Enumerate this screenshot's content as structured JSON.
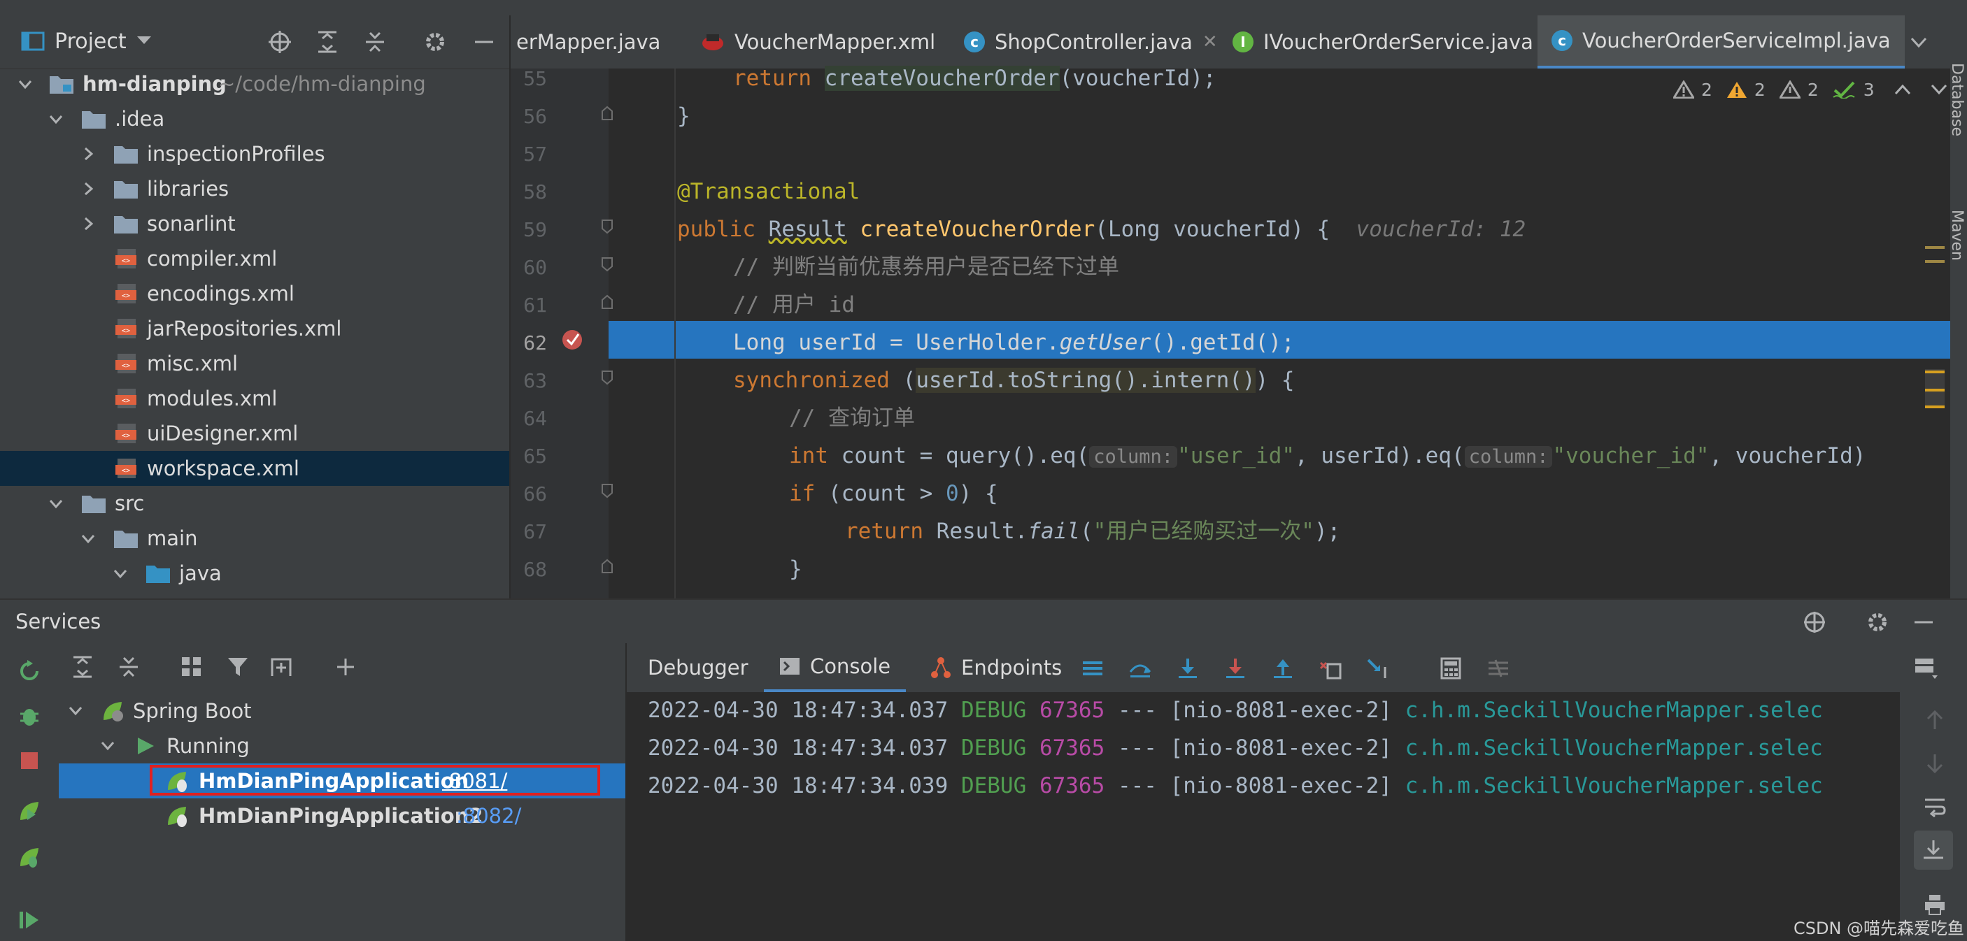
{
  "colors": {
    "accent": "#4a88c7",
    "selection": "#2675bf",
    "panel": "#3c3f41",
    "editor": "#2b2b2b"
  },
  "project_panel": {
    "title": "Project",
    "tree": [
      {
        "label": "hm-dianping",
        "extra": "~/code/hm-dianping",
        "icon": "module-folder-icon",
        "bold": true
      },
      {
        "label": ".idea",
        "icon": "folder-icon"
      },
      {
        "label": "inspectionProfiles",
        "icon": "folder-icon"
      },
      {
        "label": "libraries",
        "icon": "folder-icon"
      },
      {
        "label": "sonarlint",
        "icon": "folder-icon"
      },
      {
        "label": "compiler.xml",
        "icon": "xml-file-icon"
      },
      {
        "label": "encodings.xml",
        "icon": "xml-file-icon"
      },
      {
        "label": "jarRepositories.xml",
        "icon": "xml-file-icon"
      },
      {
        "label": "misc.xml",
        "icon": "xml-file-icon"
      },
      {
        "label": "modules.xml",
        "icon": "xml-file-icon"
      },
      {
        "label": "uiDesigner.xml",
        "icon": "xml-file-icon"
      },
      {
        "label": "workspace.xml",
        "icon": "xml-file-icon",
        "selected": true
      },
      {
        "label": "src",
        "icon": "folder-icon"
      },
      {
        "label": "main",
        "icon": "folder-icon"
      },
      {
        "label": "java",
        "icon": "source-folder-icon"
      }
    ]
  },
  "editor": {
    "tabs": [
      {
        "label": "erMapper.java",
        "kind": "c"
      },
      {
        "label": "VoucherMapper.xml",
        "kind": "xml"
      },
      {
        "label": "ShopController.java",
        "kind": "c"
      },
      {
        "label": "IVoucherOrderService.java",
        "kind": "i"
      },
      {
        "label": "VoucherOrderServiceImpl.java",
        "kind": "c",
        "active": true
      }
    ],
    "inspections": {
      "warn1": "2",
      "warn2": "2",
      "warn3": "2",
      "ok": "3"
    },
    "line_numbers": [
      "55",
      "56",
      "57",
      "58",
      "59",
      "60",
      "61",
      "62",
      "63",
      "64",
      "65",
      "66",
      "67",
      "68"
    ],
    "code": {
      "l55_return": "return ",
      "l55_call": "createVoucherOrder",
      "l55_rest": "(voucherId);",
      "l56": "}",
      "l58": "@Transactional",
      "l59_public": "public ",
      "l59_result": "Result",
      "l59_sp": " ",
      "l59_fn": "createVoucherOrder",
      "l59_rest": "(Long voucherId) {",
      "l59_hint": "voucherId: 12",
      "l60": "// 判断当前优惠券用户是否已经下过单",
      "l61": "// 用户 id",
      "l62_a": "Long userId = UserHolder.",
      "l62_b": "getUser",
      "l62_c": "().getId();",
      "l63_kw": "synchronized ",
      "l63_a": "(",
      "l63_b": "userId.toString().intern()",
      "l63_c": ") {",
      "l64": "// 查询订单",
      "l65_int": "int ",
      "l65_a": "count = query().eq(",
      "l65_hint1": "column:",
      "l65_s1": "\"user_id\"",
      "l65_b": ", userId).eq(",
      "l65_hint2": "column:",
      "l65_s2": "\"voucher_id\"",
      "l65_c": ", voucherId)",
      "l66_if": "if ",
      "l66_a": "(count > ",
      "l66_num": "0",
      "l66_b": ") {",
      "l67_ret": "return ",
      "l67_a": "Result.",
      "l67_fail": "fail",
      "l67_b": "(",
      "l67_str": "\"用户已经购买过一次\"",
      "l67_c": ");",
      "l68": "}"
    }
  },
  "right_toolwindows": {
    "database": "Database",
    "maven": "Maven"
  },
  "services": {
    "title": "Services",
    "tree": {
      "group": "Spring Boot",
      "status": "Running",
      "apps": [
        {
          "name": "HmDianPingApplication",
          "port": ":8081/",
          "selected": true
        },
        {
          "name": "HmDianPingApplication2",
          "port": ":8082/"
        }
      ]
    },
    "tabs": {
      "debugger": "Debugger",
      "console": "Console",
      "endpoints": "Endpoints"
    },
    "logs": [
      {
        "ts": "2022-04-30 18:47:34.037",
        "level": "DEBUG",
        "pid": "67365",
        "sep": "---",
        "thread": "[nio-8081-exec-2]",
        "cls": "c.h.m.SeckillVoucherMapper.selec"
      },
      {
        "ts": "2022-04-30 18:47:34.037",
        "level": "DEBUG",
        "pid": "67365",
        "sep": "---",
        "thread": "[nio-8081-exec-2]",
        "cls": "c.h.m.SeckillVoucherMapper.selec"
      },
      {
        "ts": "2022-04-30 18:47:34.039",
        "level": "DEBUG",
        "pid": "67365",
        "sep": "---",
        "thread": "[nio-8081-exec-2]",
        "cls": "c.h.m.SeckillVoucherMapper.selec"
      }
    ]
  },
  "watermark": "CSDN @喵先森爱吃鱼"
}
